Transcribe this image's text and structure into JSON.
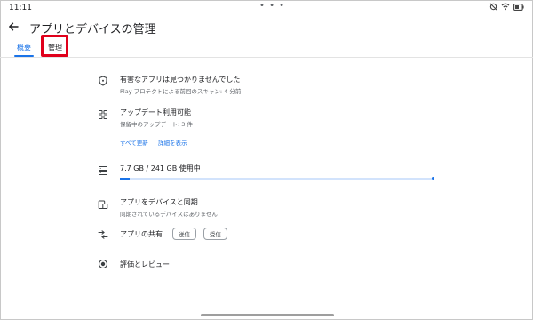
{
  "status_bar": {
    "time": "11:11"
  },
  "header": {
    "title": "アプリとデバイスの管理"
  },
  "tabs": [
    {
      "label": "概要"
    },
    {
      "label": "管理"
    }
  ],
  "sections": {
    "protect": {
      "title": "有害なアプリは見つかりませんでした",
      "subtitle": "Play プロテクトによる前回のスキャン: 4 分前"
    },
    "updates": {
      "title": "アップデート利用可能",
      "subtitle": "保留中のアップデート: 3 件",
      "update_all": "すべて更新",
      "details": "詳細を表示"
    },
    "storage": {
      "title": "7.7 GB / 241 GB 使用中",
      "used_fraction": 0.032
    },
    "sync": {
      "title": "アプリをデバイスと同期",
      "subtitle": "同期されているデバイスはありません"
    },
    "share": {
      "title": "アプリの共有",
      "send": "送信",
      "receive": "受信"
    },
    "reviews": {
      "title": "評価とレビュー"
    }
  },
  "colors": {
    "accent": "#1a73e8",
    "highlight": "#e0001b"
  },
  "icons": [
    "back-arrow-icon",
    "shield-icon",
    "apps-grid-icon",
    "storage-icon",
    "device-sync-icon",
    "share-arrows-icon",
    "star-badge-icon"
  ]
}
